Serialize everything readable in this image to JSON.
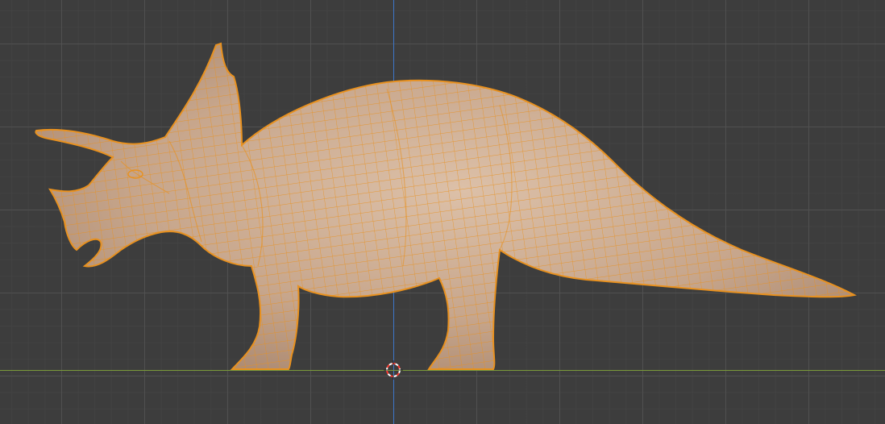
{
  "viewport": {
    "editor": "3d-viewport",
    "view": "front-orthographic",
    "grid": true,
    "colors": {
      "background": "#3d3d3d",
      "grid_major": "#525252",
      "grid_minor": "#464646",
      "x_axis": "#7a9a3a",
      "z_axis": "#3d76c9",
      "mesh_fill": "#c9a98f",
      "wireframe": "#e8911f",
      "cursor_ring_red": "#ff3b30",
      "cursor_ring_white": "#ffffff"
    }
  },
  "object": {
    "kind": "mesh",
    "subject": "triceratops",
    "selected": true,
    "display": "solid-with-wireframe"
  },
  "cursor3d": {
    "icon": "3d-cursor-icon"
  }
}
